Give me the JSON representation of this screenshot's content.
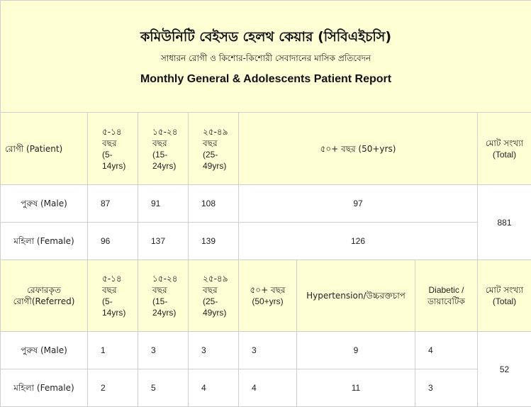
{
  "header": {
    "title_bn": "কমিউনিটি বেইসড হেলথ কেয়ার (সিবিএইচসি)",
    "subtitle_bn": "সাধারন রোগী ও কিশোর-কিশোরী সেবাদানের মাসিক প্রতিবেদন",
    "title_en": "Monthly General & Adolescents Patient Report"
  },
  "patient_section": {
    "row_label": "রোগী (Patient)",
    "age_5_14": {
      "bn": "৫-১৪ বছর",
      "en": "(5-14yrs)"
    },
    "age_15_24": {
      "bn": "১৫-২৪ বছর",
      "en": "(15-24yrs)"
    },
    "age_25_49": {
      "bn": "২৫-৪৯ বছর",
      "en": "(25-49yrs)"
    },
    "age_50_plus": "৫০+ বছর (50+yrs)",
    "total": {
      "bn": "মোট সংখ্যা",
      "en": "(Total)"
    },
    "rows": [
      {
        "label": "পুরুষ (Male)",
        "a5_14": "87",
        "a15_24": "91",
        "a25_49": "108",
        "a50_plus": "97"
      },
      {
        "label": "মহিলা (Female)",
        "a5_14": "96",
        "a15_24": "137",
        "a25_49": "139",
        "a50_plus": "126"
      }
    ],
    "total_value": "881"
  },
  "referred_section": {
    "row_label": {
      "bn": "রেফারকৃত",
      "en": "রোগী(Referred)"
    },
    "age_5_14": {
      "bn": "৫-১৪ বছর",
      "en": "(5-14yrs)"
    },
    "age_15_24": {
      "bn": "১৫-২৪ বছর",
      "en": "(15-24yrs)"
    },
    "age_25_49": {
      "bn": "২৫-৪৯ বছর",
      "en": "(25-49yrs)"
    },
    "age_50_plus": {
      "bn": "৫০+ বছর",
      "en": "(50+yrs)"
    },
    "hypertension": "Hypertension/উচ্চরক্তচাপ",
    "diabetic": {
      "en": "Diabetic /",
      "bn": "ডায়াবেটিক"
    },
    "total": {
      "bn": "মোট সংখ্যা",
      "en": "(Total)"
    },
    "rows": [
      {
        "label": "পুরুষ (Male)",
        "a5_14": "1",
        "a15_24": "3",
        "a25_49": "3",
        "a50_plus": "3",
        "hypertension": "9",
        "diabetic": "4"
      },
      {
        "label": "মহিলা (Female)",
        "a5_14": "2",
        "a15_24": "5",
        "a25_49": "4",
        "a50_plus": "4",
        "hypertension": "11",
        "diabetic": "3"
      }
    ],
    "total_value": "52"
  }
}
